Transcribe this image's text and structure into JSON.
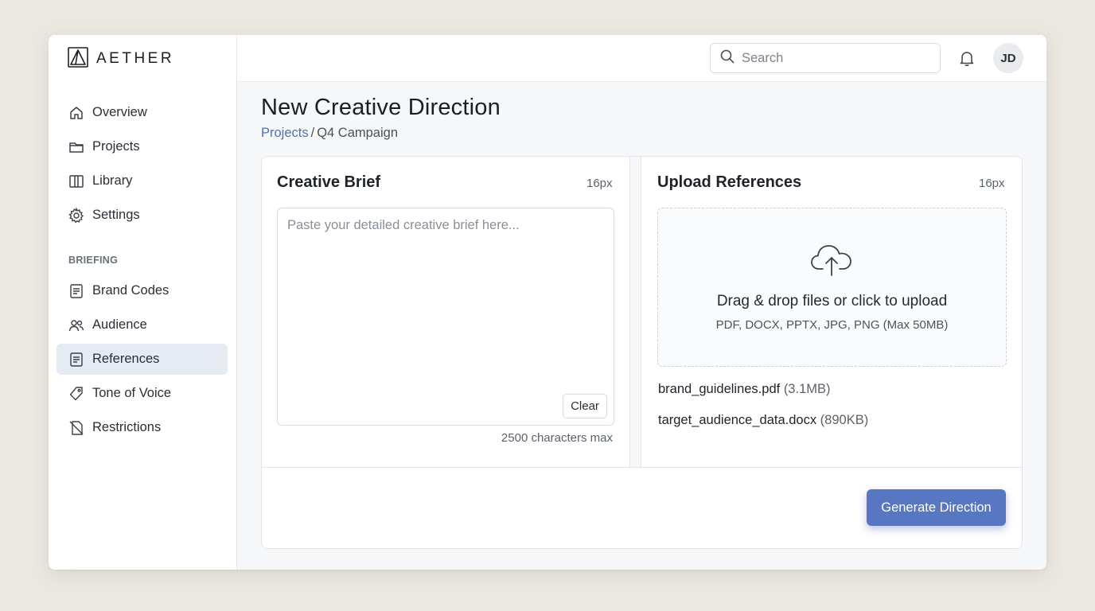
{
  "brand": {
    "name": "AETHER"
  },
  "sidebar": {
    "items": [
      {
        "label": "Overview",
        "icon": "home-icon"
      },
      {
        "label": "Projects",
        "icon": "folder-icon"
      },
      {
        "label": "Library",
        "icon": "book-icon"
      },
      {
        "label": "Settings",
        "icon": "gear-icon"
      }
    ],
    "section_label": "BRIEFING",
    "briefing_items": [
      {
        "label": "Brand Codes",
        "icon": "document-icon"
      },
      {
        "label": "Audience",
        "icon": "users-icon"
      },
      {
        "label": "References",
        "icon": "document-icon",
        "active": true
      },
      {
        "label": "Tone of Voice",
        "icon": "tag-icon"
      },
      {
        "label": "Restrictions",
        "icon": "restricted-icon"
      }
    ]
  },
  "topbar": {
    "search_placeholder": "Search",
    "avatar_initials": "JD"
  },
  "page": {
    "title": "New Creative Direction",
    "breadcrumb": {
      "parent": "Projects",
      "separator": "/",
      "current": "Q4 Campaign"
    }
  },
  "brief": {
    "title": "Creative Brief",
    "meta": "16px",
    "placeholder": "Paste your detailed creative brief here...",
    "clear_label": "Clear",
    "limit": "2500 characters max"
  },
  "upload": {
    "title": "Upload References",
    "meta": "16px",
    "drop_text": "Drag & drop files or click to upload",
    "formats": "PDF, DOCX, PPTX, JPG, PNG (Max 50MB)",
    "files": [
      {
        "name": "brand_guidelines.pdf",
        "size": "(3.1MB)"
      },
      {
        "name": "target_audience_data.docx",
        "size": "(890KB)"
      }
    ]
  },
  "actions": {
    "generate_label": "Generate Direction"
  },
  "colors": {
    "accent": "#5877c2",
    "link": "#4f73a8",
    "active_bg": "#e6ebf3",
    "background": "#ebe8e1"
  }
}
